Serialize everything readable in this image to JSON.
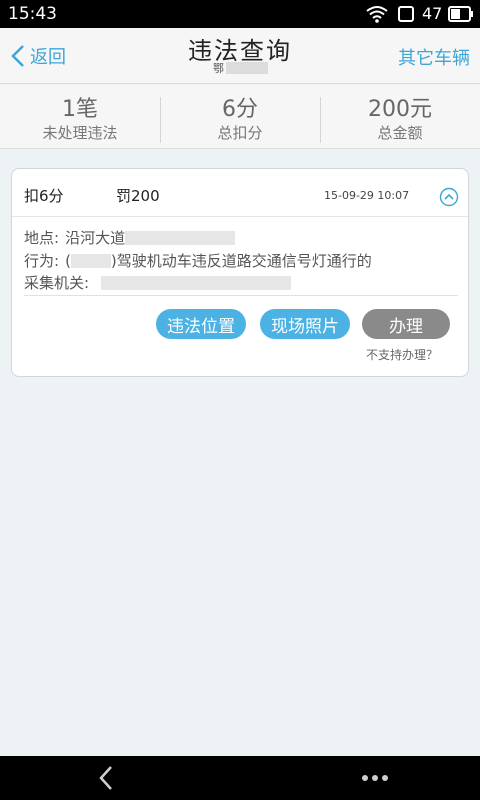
{
  "status_bar": {
    "time": "15:43",
    "battery": "47"
  },
  "header": {
    "back_label": "返回",
    "title": "违法查询",
    "plate_prefix": "鄂",
    "other_vehicles_label": "其它车辆"
  },
  "summary": [
    {
      "value": "1笔",
      "label": "未处理违法"
    },
    {
      "value": "6分",
      "label": "总扣分"
    },
    {
      "value": "200元",
      "label": "总金额"
    }
  ],
  "record": {
    "points": "扣6分",
    "fine": "罚200",
    "date": "15-09-29 10:07",
    "location_label": "地点:",
    "location_value": "沿河大道",
    "behavior_label": "行为:",
    "behavior_open": "(",
    "behavior_value": ")驾驶机动车违反道路交通信号灯通行的",
    "agency_label": "采集机关:",
    "buttons": {
      "location": "违法位置",
      "photo": "现场照片",
      "handle": "办理"
    },
    "not_supported": "不支持办理？"
  },
  "colors": {
    "accent": "#3ea6d6",
    "button_blue": "#4bb2e3",
    "button_gray": "#8a8a8a",
    "background": "#edf2f5"
  }
}
